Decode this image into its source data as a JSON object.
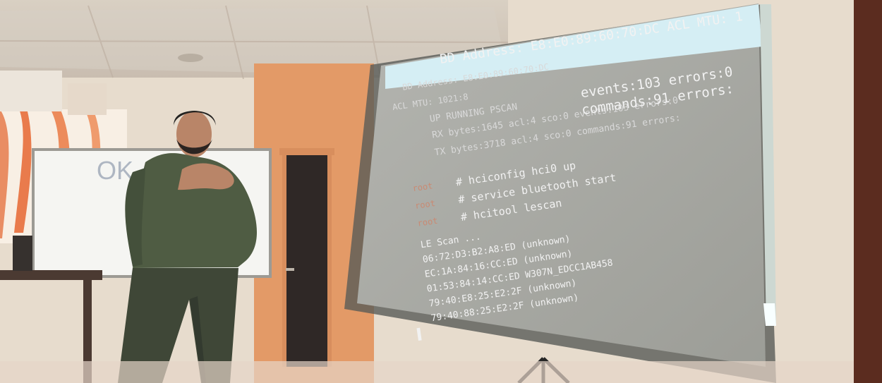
{
  "terminal": {
    "top_line": "BD Address: E8:E0:89:60:70:DC  ACL MTU: 1",
    "lines": [
      "BD Address: E8:E0:89:60:70:DC",
      "ACL MTU: 1021:8",
      "UP RUNNING PSCAN",
      "events:103 errors:0",
      "RX bytes:1645 acl:4 sco:0 events:103 errors:0",
      "commands:91 errors:",
      "TX bytes:3718 acl:4 sco:0 commands:91 errors:"
    ],
    "commands": [
      "# hciconfig hci0 up",
      "# service bluetooth start",
      "# hcitool lescan"
    ],
    "scan_header": "LE Scan ...",
    "scan_results": [
      "06:72:D3:B2:A8:ED (unknown)",
      "EC:1A:84:16:CC:ED (unknown)",
      "01:53:84:14:CC:ED W307N_EDCC1AB458",
      "79:40:E8:25:E2:2F (unknown)",
      "79:40:88:25:E2:2F (unknown)"
    ],
    "cursor": "▌"
  },
  "whiteboard": {
    "text": "OK"
  },
  "colors": {
    "wall": "#e7dccd",
    "orange_wall": "#e39a67",
    "screen": "#a9aaa6",
    "screen_dark": "#96968f",
    "terminal_bar": "#d5eef4",
    "door": "#2f2826",
    "jacket": "#4f5c43",
    "pants": "#3f4737",
    "skin": "#b98568"
  }
}
